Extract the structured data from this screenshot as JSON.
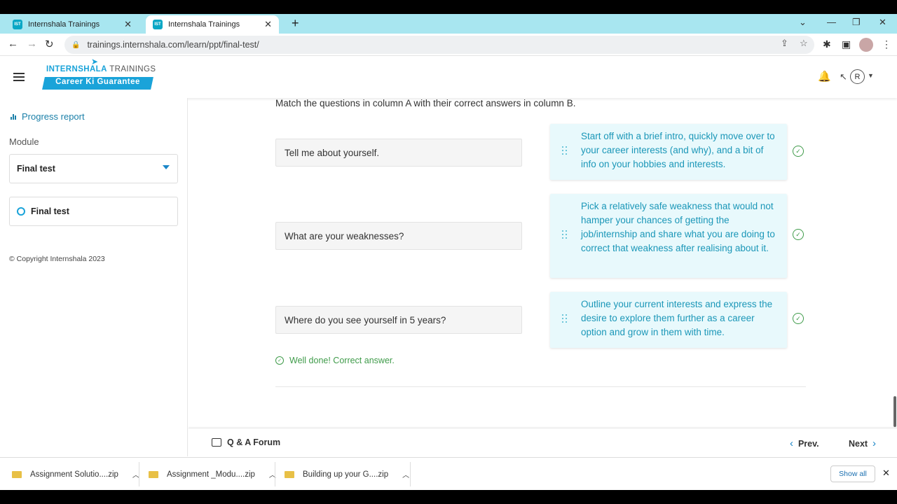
{
  "browser": {
    "tabs": [
      {
        "title": "Internshala Trainings",
        "favicon": "IST"
      },
      {
        "title": "Internshala Trainings",
        "favicon": "IST"
      }
    ],
    "url": "trainings.internshala.com/learn/ppt/final-test/"
  },
  "header": {
    "logo_line1_a": "INTERNSHALA",
    "logo_line1_b": " TRAININGS",
    "logo_badge": "Career Ki Guarantee",
    "avatar_initial": "R"
  },
  "sidebar": {
    "progress_label": "Progress report",
    "module_label": "Module",
    "module_selected": "Final test",
    "topic": "Final test",
    "copyright": "© Copyright Internshala 2023"
  },
  "main": {
    "instruction": "Match the questions in column A with their correct answers in column B.",
    "questions": [
      "Tell me about yourself.",
      "What are your weaknesses?",
      "Where do you see yourself in 5 years?"
    ],
    "answers": [
      "Start off with a brief intro, quickly move over to your career interests (and why), and a bit of info on your hobbies and interests.",
      "Pick a relatively safe weakness that would not hamper your chances of getting the job/internship and share what you are doing to correct that weakness after realising about it.",
      "Outline your current interests and express the desire to explore them further as a career option and grow in them with time."
    ],
    "feedback": "Well done! Correct answer."
  },
  "footer": {
    "forum": "Q & A Forum",
    "prev": "Prev.",
    "next": "Next"
  },
  "downloads": {
    "items": [
      "Assignment Solutio....zip",
      "Assignment _Modu....zip",
      "Building up your G....zip"
    ],
    "show_all": "Show all"
  },
  "colors": {
    "accent": "#1aa3d9",
    "answer_bg": "#e8f9fc",
    "success": "#3f9b4a"
  }
}
